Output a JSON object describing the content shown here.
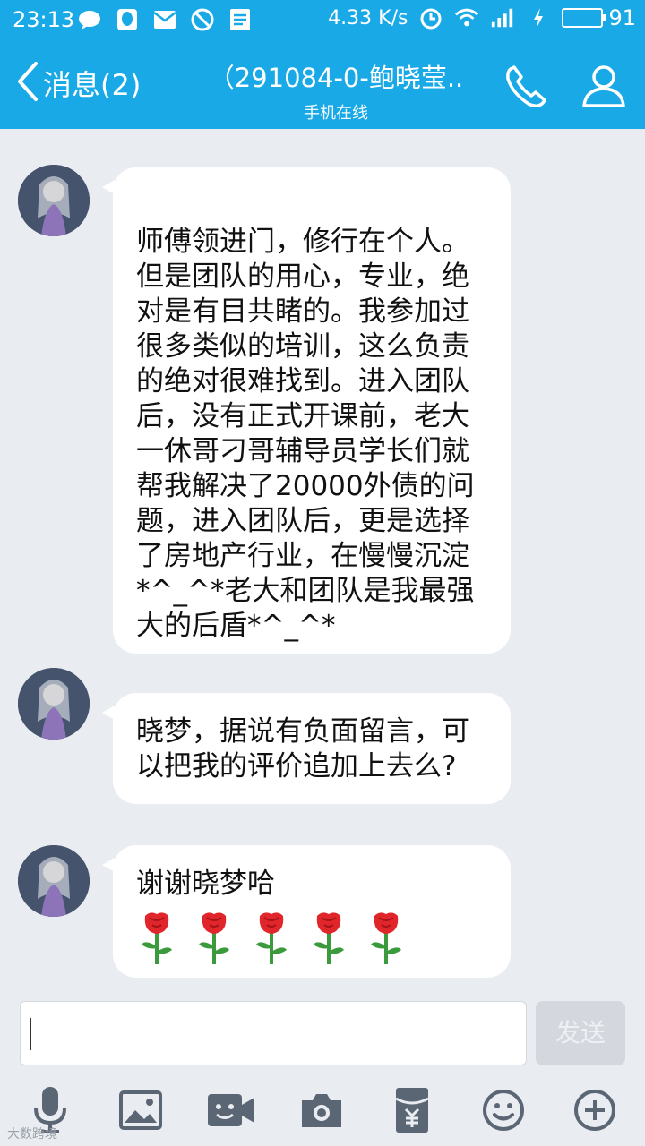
{
  "status_bar": {
    "time": "23:13",
    "net_speed": "4.33 K/s",
    "battery": "91",
    "battery_level": 0.91,
    "icons_left": [
      "chat-bubble-icon",
      "qq-icon",
      "mail-icon",
      "block-icon",
      "note-icon"
    ],
    "icons_right": [
      "clock-icon",
      "wifi-icon",
      "signal-4g-icon",
      "charging-icon",
      "battery-icon"
    ]
  },
  "header": {
    "back_label": "消息(2)",
    "title": "（291084-0-鲍晓莹..",
    "subtitle": "手机在线"
  },
  "messages": [
    {
      "text": "师傅领进门，修行在个人。但是团队的用心，专业，绝对是有目共睹的。我参加过很多类似的培训，这么负责的绝对很难找到。进入团队后，没有正式开课前，老大一休哥刁哥辅导员学长们就帮我解决了20000外债的问题，进入团队后，更是选择了房地产行业，在慢慢沉淀*^_^*老大和团队是我最强大的后盾*^_^*"
    },
    {
      "text": "晓梦，据说有负面留言，可以把我的评价追加上去么?"
    },
    {
      "text": "谢谢晓梦哈",
      "emoji": [
        "rose",
        "rose",
        "rose",
        "rose",
        "rose"
      ]
    }
  ],
  "input": {
    "value": "",
    "send_label": "发送"
  },
  "toolbar": [
    "microphone-icon",
    "image-icon",
    "video-call-icon",
    "camera-icon",
    "red-packet-icon",
    "emoji-icon",
    "plus-icon"
  ],
  "colors": {
    "header_bg": "#19a9e6",
    "chat_bg": "#e9ecf1",
    "bubble_bg": "#ffffff",
    "send_disabled": "#d4d8de"
  },
  "watermark": "大数跨境"
}
